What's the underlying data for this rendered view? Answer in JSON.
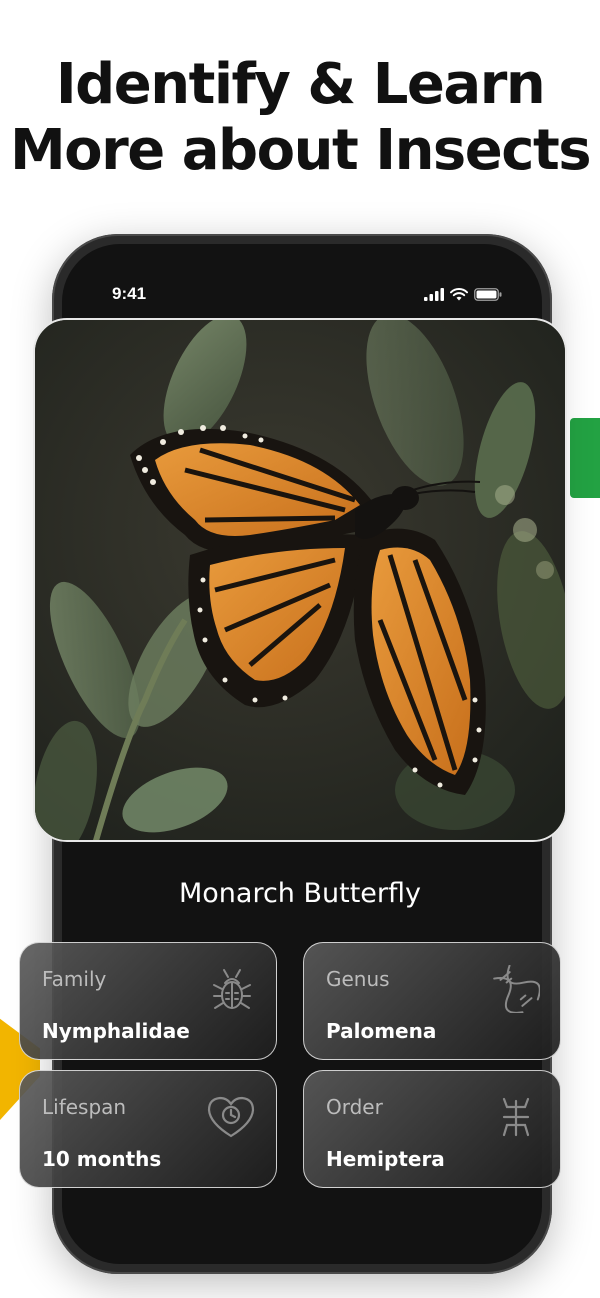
{
  "headline": {
    "line1": "Identify & Learn",
    "line2": "More about Insects"
  },
  "status_bar": {
    "time": "9:41"
  },
  "photo": {
    "subject_icon": "monarch-butterfly-photo"
  },
  "species": {
    "name": "Monarch Butterfly"
  },
  "info_cards": [
    {
      "label": "Family",
      "value": "Nymphalidae",
      "icon": "bug-icon"
    },
    {
      "label": "Genus",
      "value": "Palomena",
      "icon": "dna-icon"
    },
    {
      "label": "Lifespan",
      "value": "10 months",
      "icon": "heart-clock-icon"
    },
    {
      "label": "Order",
      "value": "Hemiptera",
      "icon": "insect-order-icon"
    }
  ],
  "colors": {
    "accent_green": "#23a243",
    "accent_yellow": "#f2b500",
    "phone_bg": "#121212"
  }
}
